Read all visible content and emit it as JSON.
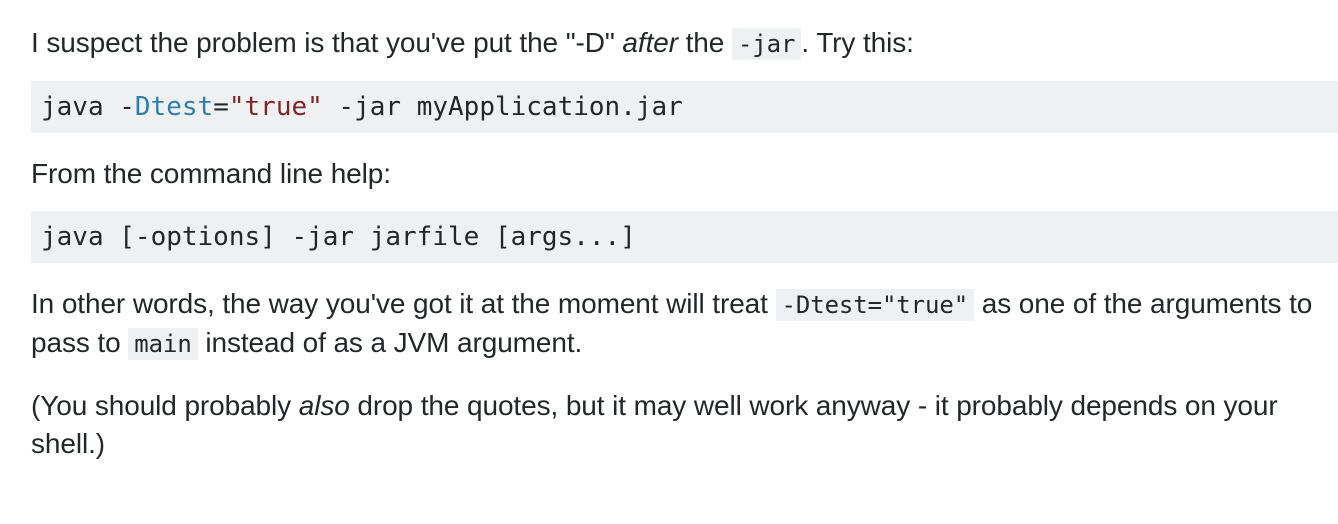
{
  "answer": {
    "p1": {
      "before": "I suspect the problem is that you've put the \"-D\" ",
      "em": "after",
      "mid": " the ",
      "code": "-jar",
      "after": ". Try this:"
    },
    "code1": {
      "t1": "java -",
      "t2": "Dtest",
      "t3": "=",
      "t4": "\"true\"",
      "t5": " -jar myApplication.jar"
    },
    "p2": {
      "text": "From the command line help:"
    },
    "code2": {
      "text": "java [-options] -jar jarfile [args...]"
    },
    "p3": {
      "before": "In other words, the way you've got it at the moment will treat ",
      "code1": "-Dtest=\"true\"",
      "mid": " as one of the arguments to pass to ",
      "code2": "main",
      "after": " instead of as a JVM argument."
    },
    "p4": {
      "before": "(You should probably ",
      "em": "also",
      "after": " drop the quotes, but it may well work anyway - it probably depends on your shell.)"
    }
  }
}
